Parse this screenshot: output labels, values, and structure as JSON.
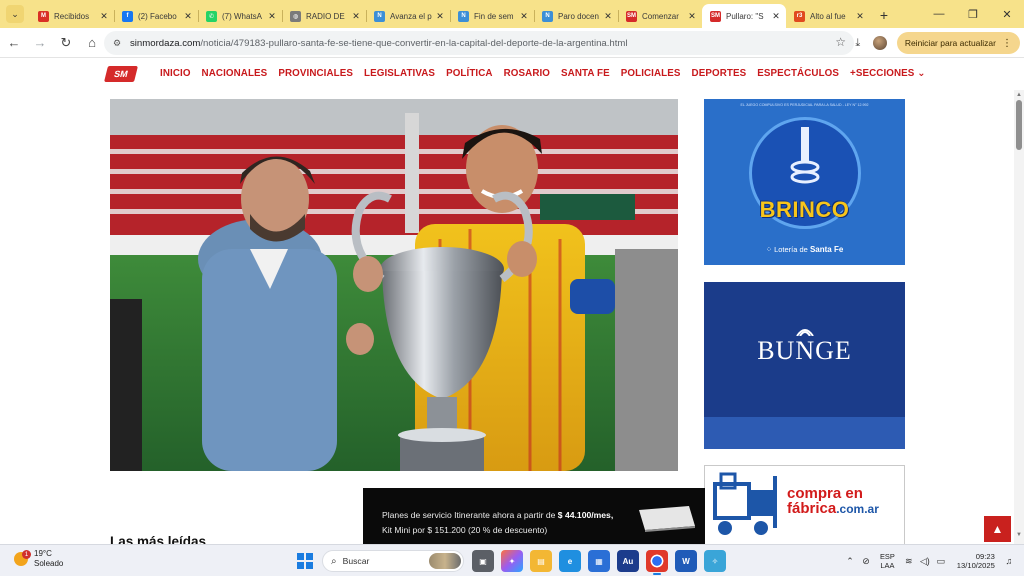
{
  "browser": {
    "tabs": [
      {
        "title": "Recibidos",
        "icon": "gmail-icon",
        "color": "#d93025",
        "glyph": "M"
      },
      {
        "title": "(2) Facebo",
        "icon": "facebook-icon",
        "color": "#1877f2",
        "glyph": "f"
      },
      {
        "title": "(7) WhatsA",
        "icon": "whatsapp-icon",
        "color": "#25d366",
        "glyph": "✆"
      },
      {
        "title": "RADIO DE",
        "icon": "globe-icon",
        "color": "#7a7a7a",
        "glyph": "◍"
      },
      {
        "title": "Avanza el p",
        "icon": "news-icon",
        "color": "#3d8fd6",
        "glyph": "N"
      },
      {
        "title": "Fin de sem",
        "icon": "news-icon",
        "color": "#3d8fd6",
        "glyph": "N"
      },
      {
        "title": "Paro docen",
        "icon": "news-icon",
        "color": "#3d8fd6",
        "glyph": "N"
      },
      {
        "title": "Comenzar",
        "icon": "sm-icon",
        "color": "#d52a2a",
        "glyph": "SM"
      },
      {
        "title": "Pullaro: \"S",
        "icon": "sm-icon",
        "color": "#d52a2a",
        "glyph": "SM",
        "active": true
      },
      {
        "title": "Alto al fue",
        "icon": "r-icon",
        "color": "#e04a1f",
        "glyph": "r3"
      }
    ],
    "new_tab": "+",
    "window_controls": {
      "minimize": "—",
      "restore": "❐",
      "close": "✕"
    },
    "url_host": "sinmordaza.com",
    "url_path": "/noticia/479183-pullaro-santa-fe-se-tiene-que-convertir-en-la-capital-del-deporte-de-la-argentina.html",
    "update_button": "Reiniciar para actualizar",
    "theme_color": "#f7e28a"
  },
  "site": {
    "logo_text": "SM",
    "brand_color": "#c8191c",
    "menu": [
      "INICIO",
      "NACIONALES",
      "PROVINCIALES",
      "LEGISLATIVAS",
      "POLÍTICA",
      "ROSARIO",
      "SANTA FE",
      "POLICIALES",
      "DEPORTES",
      "ESPECTÁCULOS",
      "+SECCIONES ⌄"
    ]
  },
  "ads": {
    "brinco": {
      "top_text": "EL JUEGO COMPULSIVO ES PERJUDICIAL PARA LA SALUD - LEY N° 12.992",
      "word": "BRINCO",
      "footer_prefix": "Lotería de ",
      "footer_brand": "Santa Fe"
    },
    "bunge": {
      "word": "BUNGE"
    },
    "compra": {
      "line1": "compra en",
      "line2": "fábrica",
      "domain": ".com.ar"
    }
  },
  "promo": {
    "line1_prefix": "Planes de servicio Itinerante ahora a partir de ",
    "line1_price": "$ 44.100/mes,",
    "line2": "Kit Mini por $ 151.200 (20 % de descuento)"
  },
  "sections": {
    "most_read": "Las más leídas"
  },
  "taskbar": {
    "weather_temp": "19°C",
    "weather_desc": "Soleado",
    "weather_badge": "1",
    "search_label": "Buscar",
    "lang_line1": "ESP",
    "lang_line2": "LAA",
    "time": "09:23",
    "date": "13/10/2025"
  }
}
